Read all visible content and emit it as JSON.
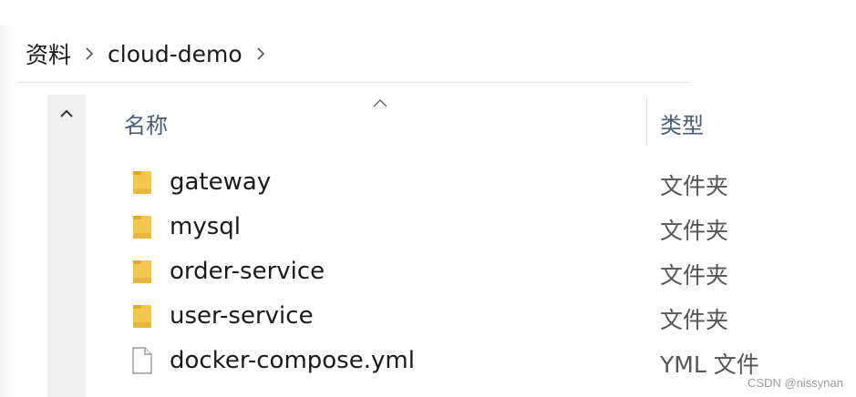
{
  "breadcrumb": {
    "items": [
      "资料",
      "cloud-demo"
    ]
  },
  "columns": {
    "name": "名称",
    "type": "类型"
  },
  "files": [
    {
      "name": "gateway",
      "type": "文件夹",
      "icon": "folder-icon"
    },
    {
      "name": "mysql",
      "type": "文件夹",
      "icon": "folder-icon"
    },
    {
      "name": "order-service",
      "type": "文件夹",
      "icon": "folder-icon"
    },
    {
      "name": "user-service",
      "type": "文件夹",
      "icon": "folder-icon"
    },
    {
      "name": "docker-compose.yml",
      "type": "YML 文件",
      "icon": "file-icon"
    }
  ],
  "watermark": "CSDN @nissynan",
  "colors": {
    "folder": "#f5c74e",
    "folder_dark": "#e0a92a",
    "header_text": "#4a5d72"
  }
}
